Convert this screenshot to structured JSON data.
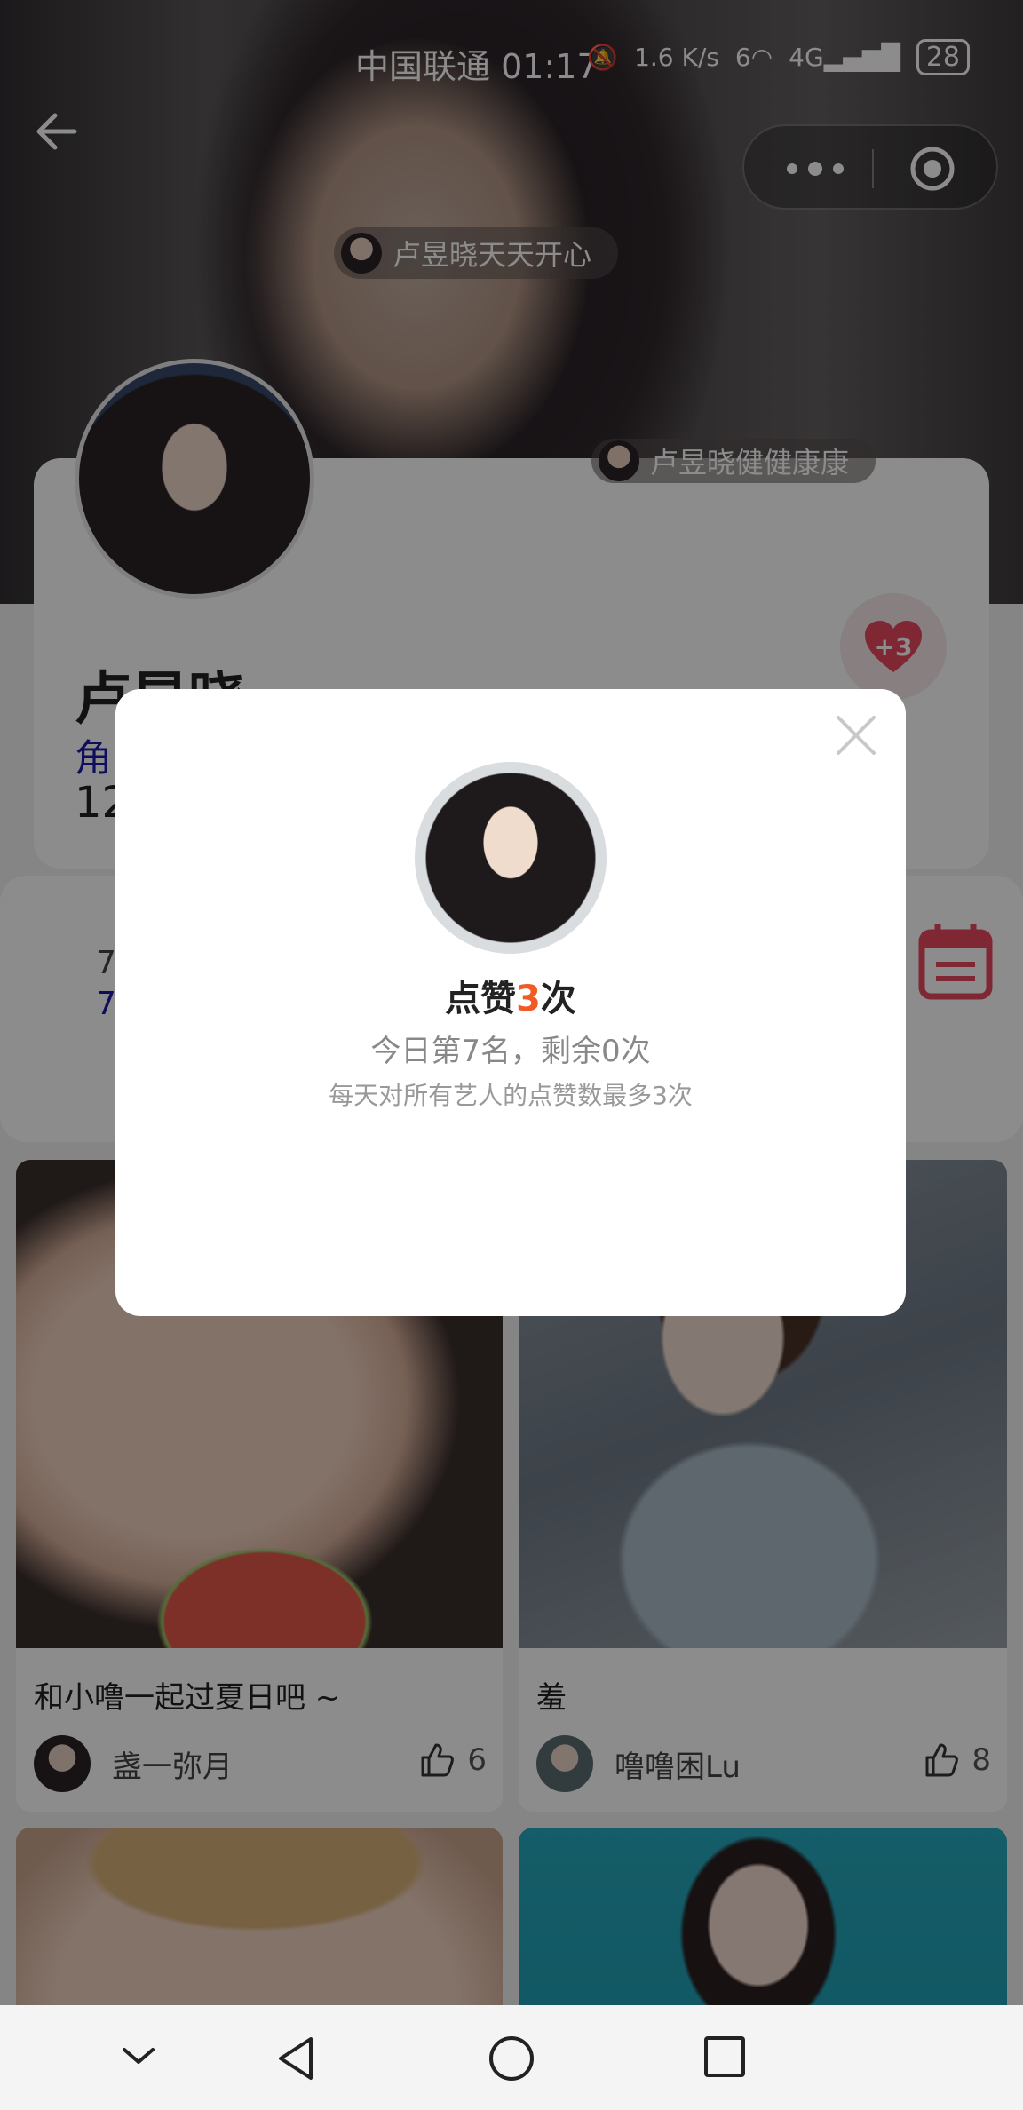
{
  "status_bar": {
    "carrier": "中国联通",
    "time": "01:17",
    "network_speed": "1.6 K/s",
    "wifi_label": "6",
    "cellular_label": "4G",
    "battery": "28"
  },
  "danmaku": [
    {
      "text": "卢昱晓天天开心"
    },
    {
      "text": "卢昱晓健健康康"
    }
  ],
  "profile": {
    "name": "卢昱晓",
    "role_partial": "角",
    "count_partial": "12",
    "heart_badge": "+3"
  },
  "stats": {
    "line1_partial": "7",
    "line2_partial": "7"
  },
  "feed": [
    {
      "title": "和小噜一起过夏日吧 ~",
      "author": "盏一弥月",
      "likes": "6"
    },
    {
      "title": "羞",
      "author": "噜噜困Lu",
      "likes": "8"
    }
  ],
  "dialog": {
    "title_prefix": "点赞",
    "title_number": "3",
    "title_suffix": "次",
    "rank_text": "今日第7名，剩余0次",
    "rule_text": "每天对所有艺人的点赞数最多3次"
  },
  "colors": {
    "accent_orange": "#f15a24",
    "heart_red": "#e84a5f",
    "role_blue": "#1a1aa8"
  },
  "icons": [
    "back-arrow-icon",
    "more-dots-icon",
    "target-icon",
    "heart-icon",
    "calendar-icon",
    "close-icon",
    "thumb-up-icon",
    "chevron-down-icon",
    "back-triangle-icon",
    "home-circle-icon",
    "recent-square-icon"
  ]
}
